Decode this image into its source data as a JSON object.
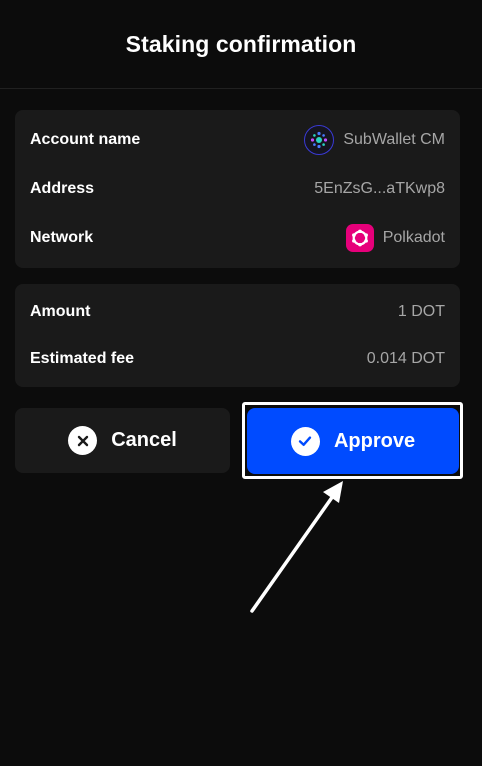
{
  "header": {
    "title": "Staking confirmation"
  },
  "info": {
    "account_label": "Account name",
    "account_value": "SubWallet CM",
    "account_icon": "subwallet-logo-icon",
    "address_label": "Address",
    "address_value": "5EnZsG...aTKwp8",
    "network_label": "Network",
    "network_value": "Polkadot",
    "network_icon": "polkadot-logo-icon"
  },
  "amounts": {
    "amount_label": "Amount",
    "amount_value": "1 DOT",
    "fee_label": "Estimated fee",
    "fee_value": "0.014 DOT"
  },
  "actions": {
    "cancel_label": "Cancel",
    "cancel_icon": "close-circle-icon",
    "approve_label": "Approve",
    "approve_icon": "check-circle-icon"
  },
  "colors": {
    "background": "#0c0c0c",
    "card": "#1a1a1a",
    "primary": "#004bff",
    "polkadot": "#e6007a",
    "muted_text": "#a6a6a6"
  }
}
